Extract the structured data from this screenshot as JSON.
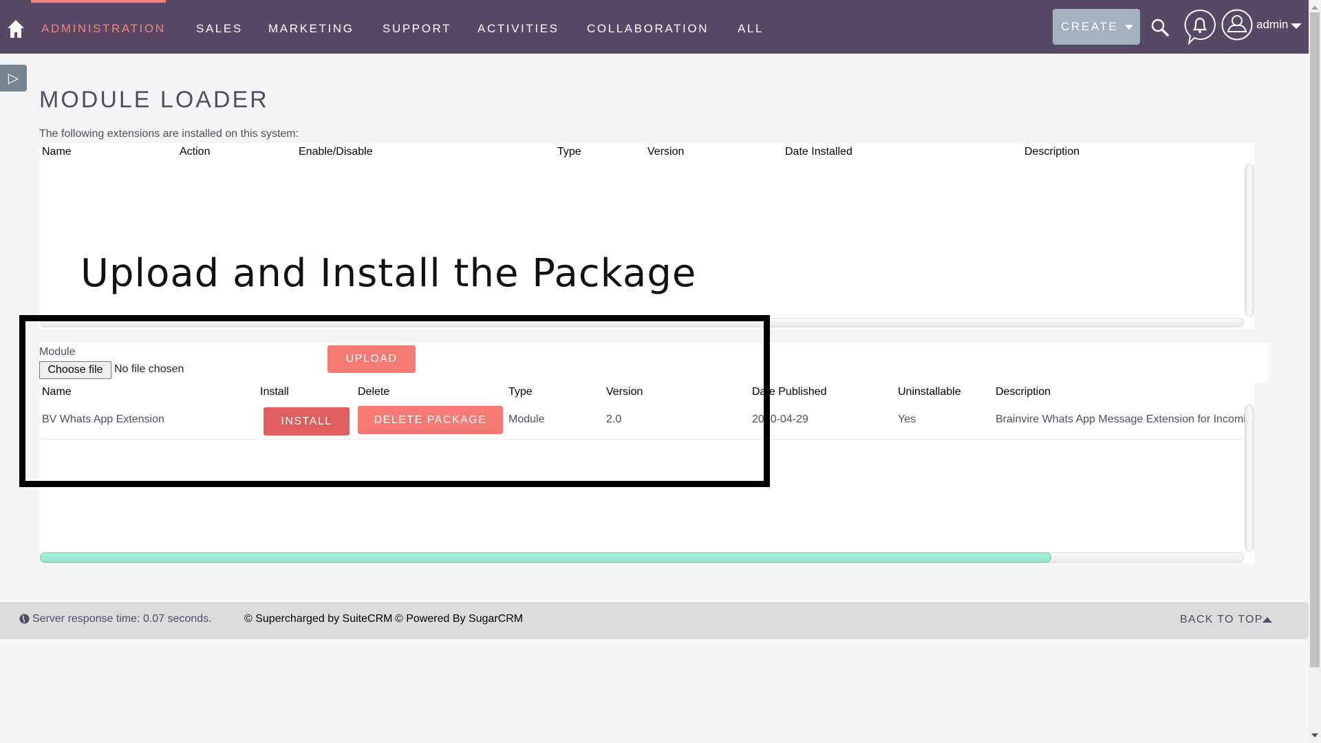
{
  "nav": {
    "items": [
      "ADMINISTRATION",
      "SALES",
      "MARKETING",
      "SUPPORT",
      "ACTIVITIES",
      "COLLABORATION",
      "ALL"
    ],
    "active": "ADMINISTRATION",
    "create_label": "CREATE",
    "user_label": "admin",
    "colors": {
      "bar": "#574965",
      "active": "#f08377"
    }
  },
  "page": {
    "title": "MODULE LOADER",
    "intro": "The following extensions are installed on this system:"
  },
  "installed_table": {
    "headers": [
      "Name",
      "Action",
      "Enable/Disable",
      "Type",
      "Version",
      "Date Installed",
      "Description"
    ],
    "rows": []
  },
  "annotation": {
    "caption": "Upload and Install the Package"
  },
  "upload": {
    "module_label": "Module",
    "choose_file_label": "Choose file",
    "file_status": "No file chosen",
    "upload_label": "UPLOAD"
  },
  "packages_table": {
    "headers": [
      "Name",
      "Install",
      "Delete",
      "Type",
      "Version",
      "Date Published",
      "Uninstallable",
      "Description"
    ],
    "rows": [
      {
        "name": "BV Whats App Extension",
        "install_label": "INSTALL",
        "delete_label": "DELETE PACKAGE",
        "type": "Module",
        "version": "2.0",
        "date_published": "2020-04-29",
        "uninstallable": "Yes",
        "description": "Brainvire Whats App Message Extension for Incoming"
      }
    ],
    "horizontal_scroll_position": 0.84
  },
  "footer": {
    "response_time": "Server response time: 0.07 seconds.",
    "suitecrm": "© Supercharged by SuiteCRM",
    "sugarcrm": "© Powered By SugarCRM",
    "back_to_top": "BACK TO TOP"
  }
}
